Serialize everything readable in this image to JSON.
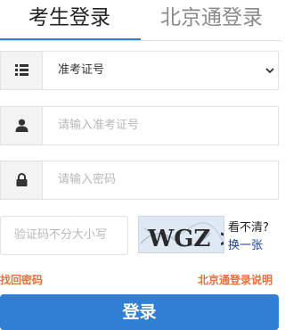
{
  "tabs": {
    "active_label": "考生登录",
    "inactive_label": "北京通登录"
  },
  "form": {
    "id_type_selected": "准考证号",
    "id_input_placeholder": "请输入准考证号",
    "password_placeholder": "请输入密码",
    "captcha_placeholder": "验证码不分大小写",
    "captcha_text": "WGZ >",
    "captcha_unclear": "看不清?",
    "captcha_refresh": "换一张"
  },
  "links": {
    "forgot_password": "找回密码",
    "beijingtong_help": "北京通登录说明"
  },
  "login_button": "登录",
  "colors": {
    "accent": "#2f7fd4",
    "link_orange": "#e7713a",
    "refresh_link": "#1a3fa8"
  },
  "icons": [
    "list-icon",
    "user-icon",
    "lock-icon",
    "chevron-down-icon"
  ]
}
